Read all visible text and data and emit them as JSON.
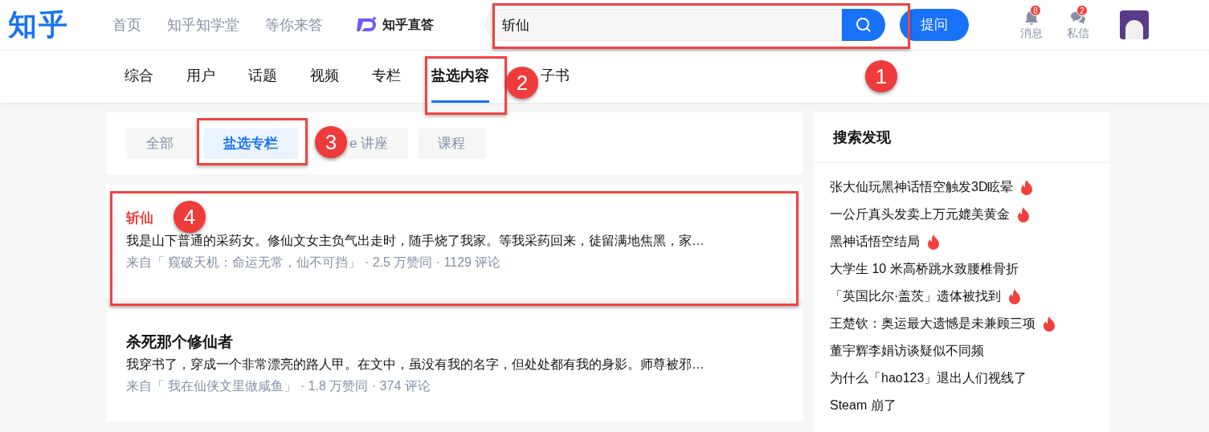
{
  "header": {
    "logo": "知乎",
    "nav": [
      "首页",
      "知乎知学堂",
      "等你来答"
    ],
    "brand": "知乎直答",
    "search": {
      "value": "斩仙"
    },
    "ask_button": "提问",
    "notifications": {
      "label": "消息",
      "badge": "8"
    },
    "messages": {
      "label": "私信",
      "badge": "2"
    }
  },
  "tabs": [
    {
      "label": "综合",
      "selected": false
    },
    {
      "label": "用户",
      "selected": false
    },
    {
      "label": "话题",
      "selected": false
    },
    {
      "label": "视频",
      "selected": false
    },
    {
      "label": "专栏",
      "selected": false
    },
    {
      "label": "盐选内容",
      "selected": true
    },
    {
      "label": "子书",
      "selected": false
    }
  ],
  "subtabs": [
    {
      "label": "全部",
      "selected": false
    },
    {
      "label": "盐选专栏",
      "selected": true
    },
    {
      "label": "e 讲座",
      "selected": false
    },
    {
      "label": "课程",
      "selected": false
    }
  ],
  "results": [
    {
      "title": "斩仙",
      "highlighted": true,
      "excerpt": "我是山下普通的采药女。修仙文女主负气出走时，随手烧了我家。等我采药回来，徒留满地焦黑，家…",
      "source": "来自「 窥破天机：命运无常，仙不可挡」",
      "stats": " · 2.5 万赞同 · 1129 评论"
    },
    {
      "title": "杀死那个修仙者",
      "highlighted": false,
      "excerpt": "我穿书了，穿成一个非常漂亮的路人甲。在文中，虽没有我的名字，但处处都有我的身影。师尊被邪…",
      "source": "来自「 我在仙侠文里做咸鱼」",
      "stats": " · 1.8 万赞同 · 374 评论"
    }
  ],
  "sidebar": {
    "title": "搜索发现",
    "items": [
      {
        "text": "张大仙玩黑神话悟空触发3D眩晕",
        "hot": true
      },
      {
        "text": "一公斤真头发卖上万元媲美黄金",
        "hot": true
      },
      {
        "text": "黑神话悟空结局",
        "hot": true
      },
      {
        "text": "大学生 10 米高桥跳水致腰椎骨折",
        "hot": false
      },
      {
        "text": "「英国比尔·盖茨」遗体被找到",
        "hot": true
      },
      {
        "text": "王楚钦：奥运最大遗憾是未兼顾三项",
        "hot": true
      },
      {
        "text": "董宇辉李娟访谈疑似不同频",
        "hot": false
      },
      {
        "text": "为什么「hao123」退出人们视线了",
        "hot": false
      },
      {
        "text": "Steam 崩了",
        "hot": false
      }
    ]
  },
  "callouts": [
    "1",
    "2",
    "3",
    "4"
  ]
}
